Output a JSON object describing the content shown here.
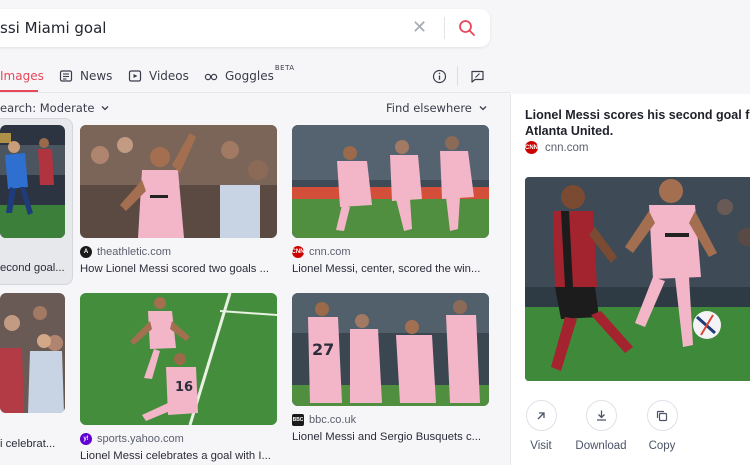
{
  "search": {
    "query": "ssi Miami goal"
  },
  "tabs": [
    {
      "label": "Images",
      "icon": "image-icon",
      "active": true
    },
    {
      "label": "News",
      "icon": "news-icon"
    },
    {
      "label": "Videos",
      "icon": "video-icon"
    },
    {
      "label": "Goggles",
      "badge": "BETA",
      "icon": "goggles-icon"
    }
  ],
  "filters": {
    "safesearch": "earch: Moderate",
    "find_elsewhere": "Find elsewhere"
  },
  "results": [
    {
      "source": "",
      "caption": "econd goal..."
    },
    {
      "source": "theathletic.com",
      "caption": "How Lionel Messi scored two goals ..."
    },
    {
      "source": "cnn.com",
      "caption": "Lionel Messi, center, scored the win..."
    },
    {
      "source": "",
      "caption": "i celebrat..."
    },
    {
      "source": "sports.yahoo.com",
      "caption": "Lionel Messi celebrates a goal with I..."
    },
    {
      "source": "bbc.co.uk",
      "caption": "Lionel Messi and Sergio Busquets c..."
    }
  ],
  "panel": {
    "title_line1": "Lionel Messi scores his second goal f",
    "title_line2": "Atlanta United.",
    "source": "cnn.com",
    "actions": [
      {
        "label": "Visit"
      },
      {
        "label": "Download"
      },
      {
        "label": "Copy"
      }
    ]
  },
  "colors": {
    "accent": "#e8485a",
    "pink_kit": "#f2b6c8",
    "pitch": "#3f8a3a"
  }
}
